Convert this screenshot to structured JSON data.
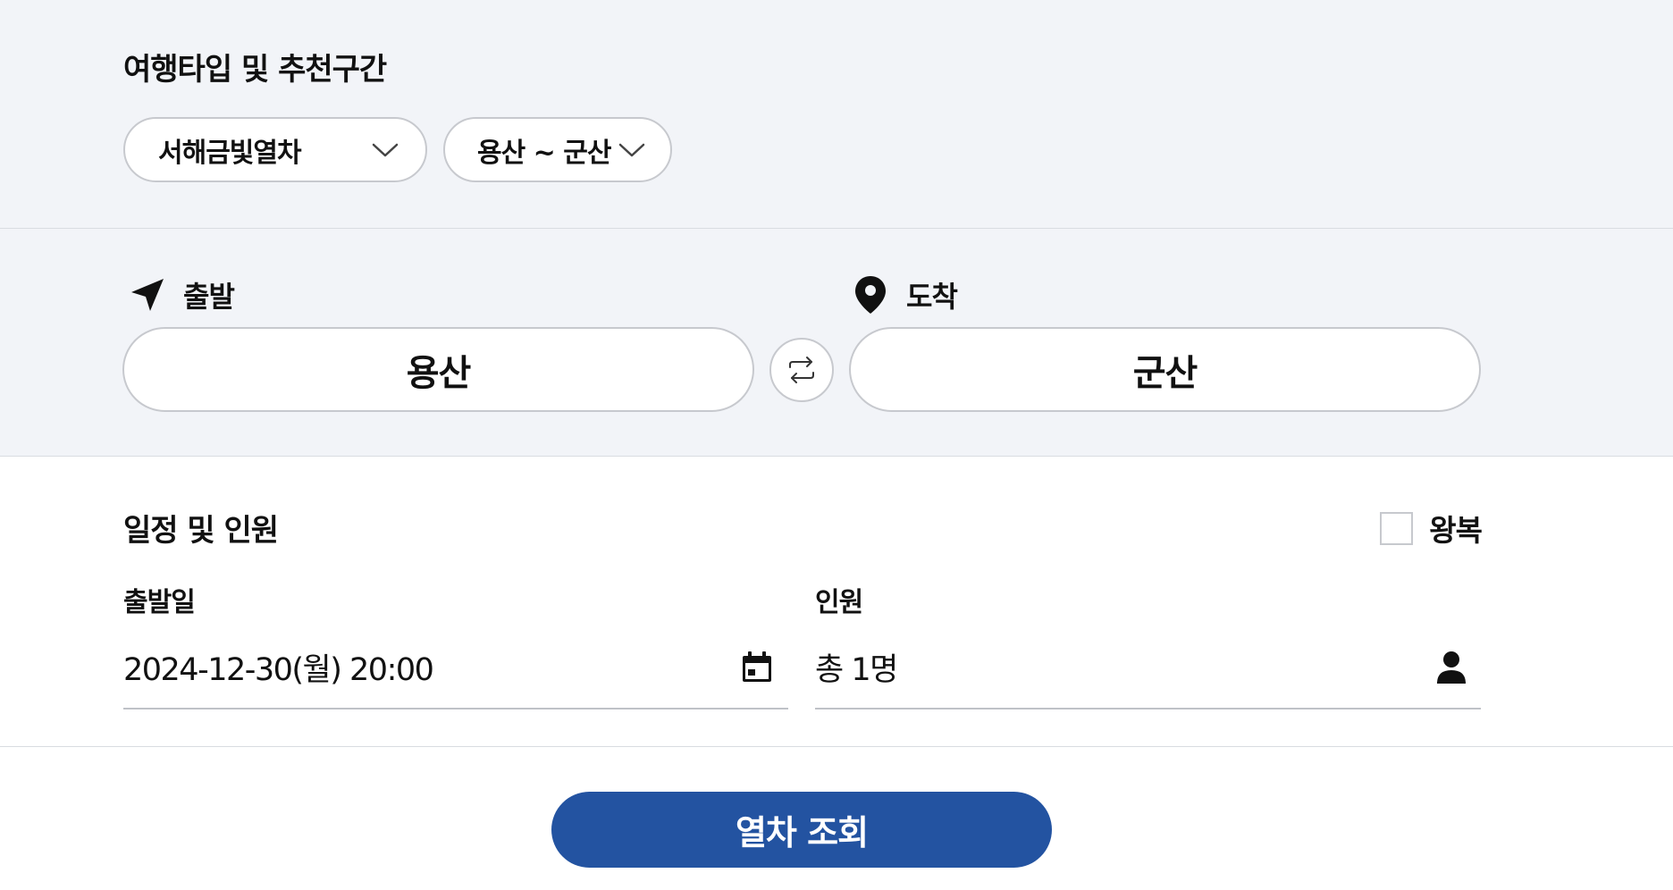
{
  "travel_type": {
    "title": "여행타입 및 추천구간",
    "type_select": {
      "value": "서해금빛열차"
    },
    "route_select": {
      "value": "용산 ~ 군산"
    }
  },
  "stations": {
    "departure_label": "출발",
    "departure_value": "용산",
    "arrival_label": "도착",
    "arrival_value": "군산"
  },
  "schedule": {
    "title": "일정 및 인원",
    "roundtrip_label": "왕복",
    "roundtrip_checked": false,
    "date_label": "출발일",
    "date_value": "2024-12-30(월) 20:00",
    "passengers_label": "인원",
    "passengers_value": "총 1명"
  },
  "search_button_label": "열차 조회",
  "colors": {
    "accent": "#2353a1",
    "section_bg": "#f2f4f8",
    "border": "#c7c9ce"
  },
  "icons": {
    "chevron": "chevron-down-icon",
    "departure": "navigation-arrow-icon",
    "arrival": "location-pin-icon",
    "swap": "swap-arrows-icon",
    "calendar": "calendar-icon",
    "person": "person-icon"
  }
}
